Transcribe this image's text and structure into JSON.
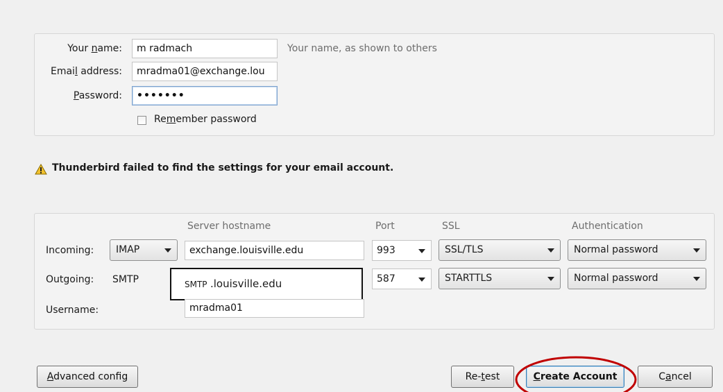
{
  "account": {
    "name_label_pre": "Your ",
    "name_label_key": "n",
    "name_label_post": "ame:",
    "name_value": "m radmach",
    "name_hint": "Your name, as shown to others",
    "email_label_pre": "Emai",
    "email_label_key": "l",
    "email_label_post": " address:",
    "email_value": "mradma01@exchange.lou",
    "password_label_key": "P",
    "password_label_post": "assword:",
    "password_value": "•••••••",
    "remember_pre": "Re",
    "remember_key": "m",
    "remember_post": "ember password",
    "remember_checked": false
  },
  "warning": {
    "icon": "warning-triangle-icon",
    "text": "Thunderbird failed to find the settings for your email account."
  },
  "server": {
    "headers": {
      "hostname": "Server hostname",
      "port": "Port",
      "ssl": "SSL",
      "auth": "Authentication"
    },
    "incoming": {
      "label": "Incoming:",
      "protocol": "IMAP",
      "hostname": "exchange.louisville.edu",
      "port": "993",
      "ssl": "SSL/TLS",
      "auth": "Normal password"
    },
    "outgoing": {
      "label": "Outgoing:",
      "protocol": "SMTP",
      "hostname_prefix": "SMTP",
      "hostname_rest": ".louisville.edu",
      "port": "587",
      "ssl": "STARTTLS",
      "auth": "Normal password"
    },
    "username": {
      "label": "Username:",
      "value": "mradma01"
    }
  },
  "buttons": {
    "advanced_key": "A",
    "advanced_rest": "dvanced config",
    "retest_pre": "Re-",
    "retest_key": "t",
    "retest_post": "est",
    "create_key": "C",
    "create_rest": "reate Account",
    "cancel_pre": "C",
    "cancel_key": "a",
    "cancel_post": "ncel"
  },
  "colors": {
    "highlight_circle": "#c00000",
    "warning_fill": "#f2c12e"
  }
}
